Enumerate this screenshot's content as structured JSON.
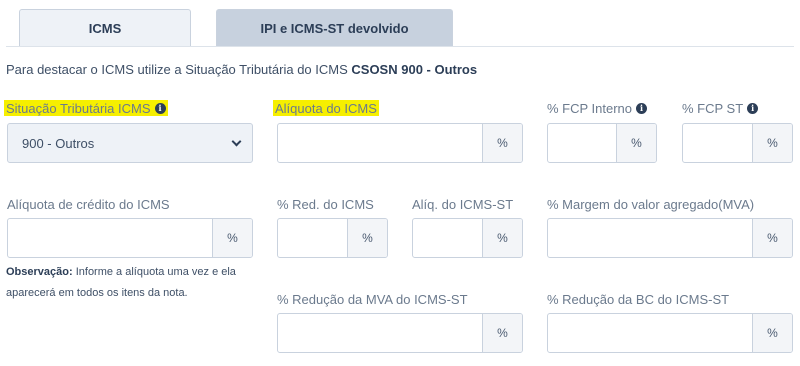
{
  "tabs": [
    {
      "label": "ICMS"
    },
    {
      "label": "IPI e ICMS-ST devolvido"
    }
  ],
  "intro": {
    "text": "Para destacar o ICMS utilize a Situação Tributária do ICMS ",
    "strong": "CSOSN 900 - Outros"
  },
  "fields": {
    "situacao": {
      "label": "Situação Tributária ICMS",
      "value": "900 - Outros"
    },
    "aliquota_icms": {
      "label": "Alíquota do ICMS",
      "suffix": "%"
    },
    "fcp_interno": {
      "label": "% FCP Interno",
      "suffix": "%"
    },
    "fcp_st": {
      "label": "% FCP ST",
      "suffix": "%"
    },
    "aliquota_credito": {
      "label": "Alíquota de crédito do ICMS",
      "suffix": "%"
    },
    "red_icms": {
      "label": "% Red. do ICMS",
      "suffix": "%"
    },
    "aliq_icms_st": {
      "label": "Alíq. do ICMS-ST",
      "suffix": "%"
    },
    "mva": {
      "label": "% Margem do valor agregado(MVA)",
      "suffix": "%"
    },
    "red_mva_st": {
      "label": "% Redução da MVA do ICMS-ST",
      "suffix": "%"
    },
    "red_bc_st": {
      "label": "% Redução da BC do ICMS-ST",
      "suffix": "%"
    }
  },
  "note": {
    "strong": "Observação:",
    "text": " Informe a alíquota uma vez e ela aparecerá em todos os itens da nota."
  },
  "info_icon_glyph": "i",
  "colors": {
    "highlight": "#f6ef00",
    "tab_active": "#eef2f7",
    "tab_inactive": "#c7d1de",
    "text_dark": "#2c3e57"
  }
}
